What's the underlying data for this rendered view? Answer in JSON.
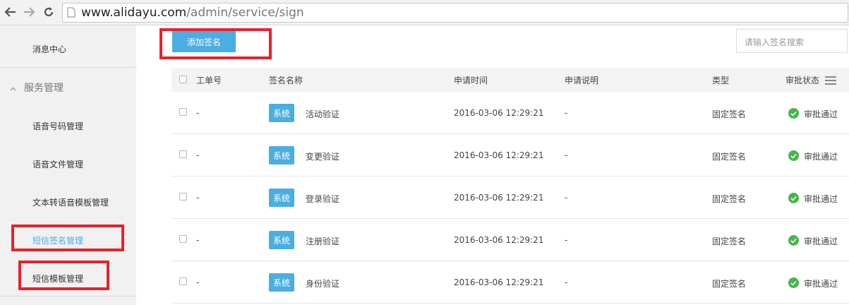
{
  "browser": {
    "url_host": "www.alidayu.com",
    "url_path": "/admin/service/sign"
  },
  "sidebar": {
    "top_item": "消息中心",
    "group_label": "服务管理",
    "items": [
      {
        "label": "语音号码管理"
      },
      {
        "label": "语音文件管理"
      },
      {
        "label": "文本转语音模板管理"
      },
      {
        "label": "短信签名管理"
      },
      {
        "label": "短信模板管理"
      }
    ]
  },
  "toolbar": {
    "add_label": "添加签名",
    "search_placeholder": "请输入签名搜索"
  },
  "table": {
    "headers": [
      "工单号",
      "签名名称",
      "申请时间",
      "申请说明",
      "类型",
      "审批状态"
    ],
    "rows": [
      {
        "order": "-",
        "tag": "系统",
        "name": "活动验证",
        "time": "2016-03-06 12:29:21",
        "note": "-",
        "type": "固定签名",
        "status": "审批通过"
      },
      {
        "order": "-",
        "tag": "系统",
        "name": "变更验证",
        "time": "2016-03-06 12:29:21",
        "note": "-",
        "type": "固定签名",
        "status": "审批通过"
      },
      {
        "order": "-",
        "tag": "系统",
        "name": "登录验证",
        "time": "2016-03-06 12:29:21",
        "note": "-",
        "type": "固定签名",
        "status": "审批通过"
      },
      {
        "order": "-",
        "tag": "系统",
        "name": "注册验证",
        "time": "2016-03-06 12:29:21",
        "note": "-",
        "type": "固定签名",
        "status": "审批通过"
      },
      {
        "order": "-",
        "tag": "系统",
        "name": "身份验证",
        "time": "2016-03-06 12:29:21",
        "note": "-",
        "type": "固定签名",
        "status": "审批通过"
      }
    ]
  },
  "colors": {
    "accent": "#4aaee2",
    "highlight_box": "#e8212a",
    "status_ok": "#45b649"
  }
}
